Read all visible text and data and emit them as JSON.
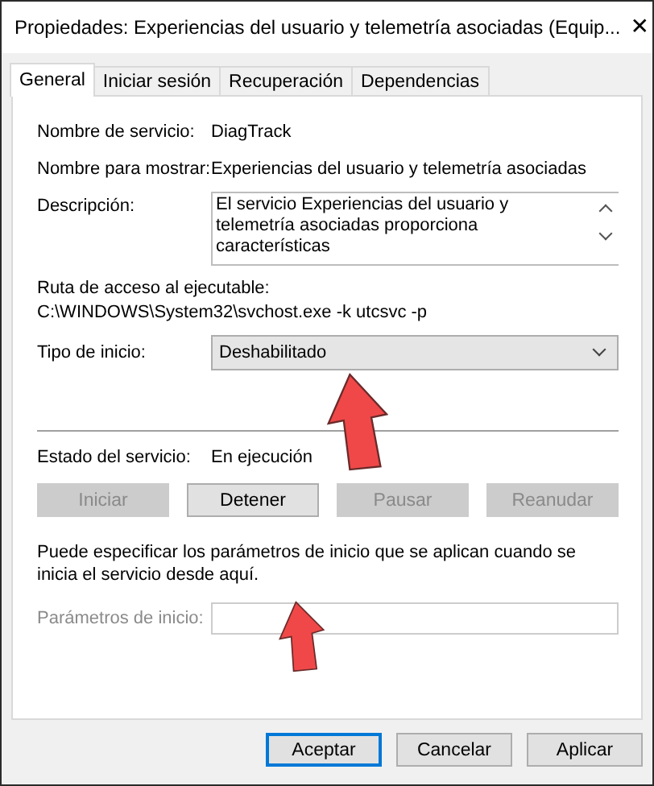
{
  "window": {
    "title": "Propiedades: Experiencias del usuario y telemetría asociadas (Equip...",
    "close": "✕"
  },
  "tabs": [
    {
      "label": "General",
      "selected": true
    },
    {
      "label": "Iniciar sesión",
      "selected": false
    },
    {
      "label": "Recuperación",
      "selected": false
    },
    {
      "label": "Dependencias",
      "selected": false
    }
  ],
  "service_name": {
    "label": "Nombre de servicio:",
    "value": "DiagTrack"
  },
  "display_name": {
    "label": "Nombre para mostrar:",
    "value": "Experiencias del usuario y telemetría asociadas"
  },
  "description": {
    "label": "Descripción:",
    "value": "El servicio Experiencias del usuario y telemetría asociadas proporciona características"
  },
  "executable_path": {
    "label": "Ruta de acceso al ejecutable:",
    "value": "C:\\WINDOWS\\System32\\svchost.exe -k utcsvc -p"
  },
  "startup_type": {
    "label": "Tipo de inicio:",
    "value": "Deshabilitado"
  },
  "service_status": {
    "label": "Estado del servicio:",
    "value": "En ejecución"
  },
  "service_buttons": [
    {
      "label": "Iniciar",
      "disabled": true
    },
    {
      "label": "Detener",
      "disabled": false
    },
    {
      "label": "Pausar",
      "disabled": true
    },
    {
      "label": "Reanudar",
      "disabled": true
    }
  ],
  "hint": "Puede especificar los parámetros de inicio que se aplican cuando se inicia el servicio desde aquí.",
  "start_parameters": {
    "label": "Parámetros de inicio:",
    "disabled": true
  },
  "dialog_buttons": [
    {
      "label": "Aceptar",
      "default": true
    },
    {
      "label": "Cancelar",
      "default": false
    },
    {
      "label": "Aplicar",
      "default": false
    }
  ]
}
